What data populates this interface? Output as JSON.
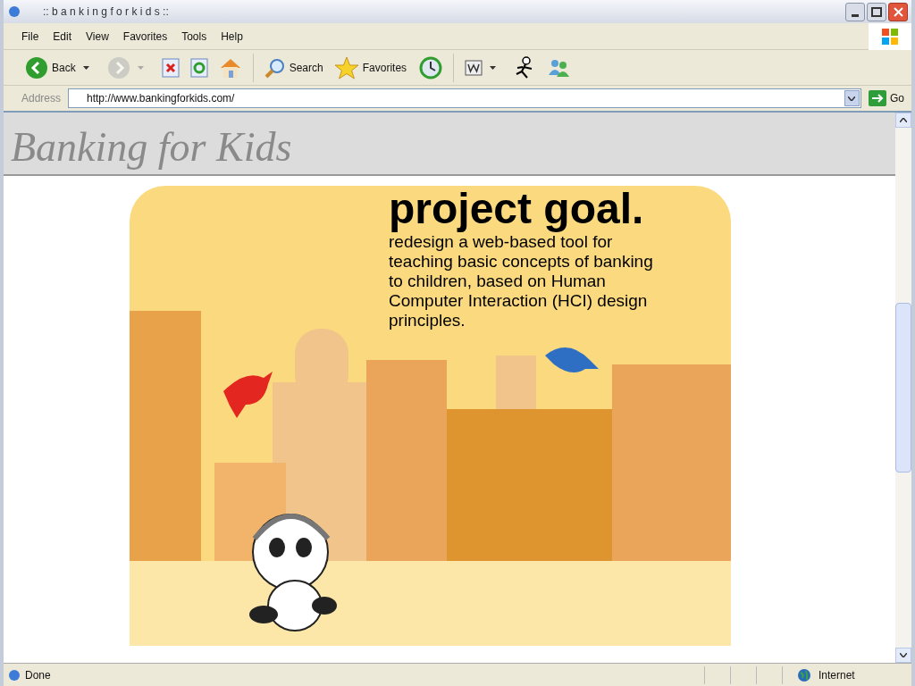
{
  "window": {
    "title": ":: b a n k i n g f o r k i d s ::"
  },
  "menu": [
    {
      "label": "File"
    },
    {
      "label": "Edit"
    },
    {
      "label": "View"
    },
    {
      "label": "Favorites"
    },
    {
      "label": "Tools"
    },
    {
      "label": "Help"
    }
  ],
  "toolbar": [
    {
      "kind": "back",
      "label": "Back",
      "disabled": false
    },
    {
      "kind": "forward",
      "disabled": true
    },
    {
      "kind": "stop",
      "disabled": false
    },
    {
      "kind": "refresh",
      "disabled": false
    },
    {
      "kind": "home",
      "disabled": false
    },
    {
      "kind": "search",
      "label": "Search",
      "disabled": false
    },
    {
      "kind": "favorites",
      "label": "Favorites",
      "disabled": false
    },
    {
      "kind": "history",
      "disabled": false
    },
    {
      "kind": "word",
      "disabled": false
    },
    {
      "kind": "aim",
      "disabled": false
    },
    {
      "kind": "messenger",
      "disabled": false
    }
  ],
  "address": {
    "label": "Address",
    "value": "http://www.bankingforkids.com/",
    "go": "Go"
  },
  "page": {
    "logo": "Banking for Kids",
    "heading": "project goal.",
    "text": "redesign a web-based tool for teaching basic concepts of banking to children, based on Human Computer Interaction (HCI) design principles."
  },
  "status_bar": {
    "text": "Done",
    "zone": "Internet"
  }
}
